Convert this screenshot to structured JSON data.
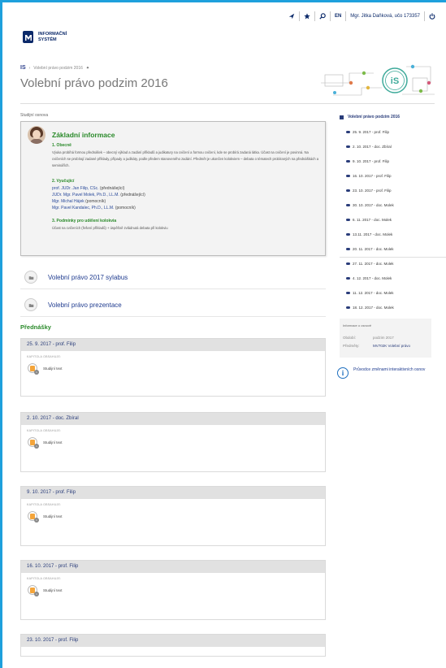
{
  "header": {
    "language": "EN",
    "user": "Mgr. Jitka Daňková, učo 173357",
    "logo_line1": "INFORMAČNÍ",
    "logo_line2": "SYSTÉM",
    "logo_mark": "MU"
  },
  "breadcrumb": {
    "root": "IS",
    "separator": "›",
    "current": "Volební právo podzim 2016"
  },
  "page_title": "Volební právo podzim 2016",
  "osnova_label": "Studijní osnova",
  "info": {
    "heading": "Základní informace",
    "s1_title": "1. Obecně",
    "s1_text": "Výuka probíhá formou přednášek – obecný výklad a zadání příkladů a judikatury na cvičení a formou cvičení, kde se probírá zadaná látka. Účast na cvičení je povinná. Na cvičeních se probírají zadané příklady, případy a judikáty, podle předem stanoveného zadání. Předmět je ukončen kolokviem – debata o tématech probíraných na přednáškách a seminářích.",
    "s2_title": "2. Vyučující",
    "teachers": [
      {
        "name": "prof. JUDr. Jan Filip, CSc.",
        "role": "(přednášející)"
      },
      {
        "name": "JUDr. Mgr. Pavel Molek, Ph.D., LL.M.",
        "role": "(přednášející)"
      },
      {
        "name": "Mgr. Michal Hájek",
        "role": "(pomocník)"
      },
      {
        "name": "Mgr. Pavel Kandalec, Ph.D., LL.M.",
        "role": "(pomocník)"
      }
    ],
    "s3_title": "3. Podmínky pro udělení kolokvia",
    "s3_text": "Účast na cvičeních (řešení příkladů) + úspěšně zvládnutá debata při kolokviu"
  },
  "materials": [
    {
      "label": "Volební právo 2017 sylabus"
    },
    {
      "label": "Volební právo prezentace"
    }
  ],
  "lectures_heading": "Přednášky",
  "kapitola_label": "KAPITOLA OBSAHUJE:",
  "doc_label": "Studijní text",
  "doc_badge": "1",
  "lectures": [
    {
      "title": "25. 9. 2017 - prof. Filip"
    },
    {
      "title": "2. 10. 2017 - doc. Zbíral"
    },
    {
      "title": "9. 10. 2017 - prof. Filip"
    },
    {
      "title": "16. 10. 2017 - prof. Filip"
    },
    {
      "title": "23. 10. 2017 - prof. Filip"
    }
  ],
  "toc": {
    "title": "Volební právo podzim 2016",
    "items": [
      "25. 9. 2017 - prof. Filip",
      "2. 10. 2017 - doc. Zbíral",
      "9. 10. 2017 - prof. Filip",
      "16. 10. 2017 - prof. Filip",
      "23. 10. 2017 - prof. Filip",
      "30. 10. 2017 - doc. Molek",
      "6. 11. 2017 - doc. Molek",
      "13.11. 2017 - doc. Molek",
      "20. 11. 2017 - doc. Molek",
      "27. 11. 2017 - doc. Molek",
      "4. 12. 2017 - doc. Molek",
      "11. 12. 2017 - doc. Molek",
      "18. 12. 2017 - doc. Molek"
    ]
  },
  "info_panel": {
    "title": "Informace o osnově",
    "period_label": "Období:",
    "period_value": "podzim 2017",
    "courses_label": "Předměty:",
    "courses_value": "MV702K Volební právo"
  },
  "guide_text": "Průvodce změnami interaktivních osnov",
  "colors": {
    "accent": "#1ea0dc",
    "brand": "#0c2a6a",
    "green": "#2a8a2a",
    "link": "#2a3d7a"
  },
  "icons": [
    "plane-icon",
    "star-icon",
    "search-icon",
    "power-icon",
    "folder-icon",
    "document-icon",
    "info-icon"
  ]
}
